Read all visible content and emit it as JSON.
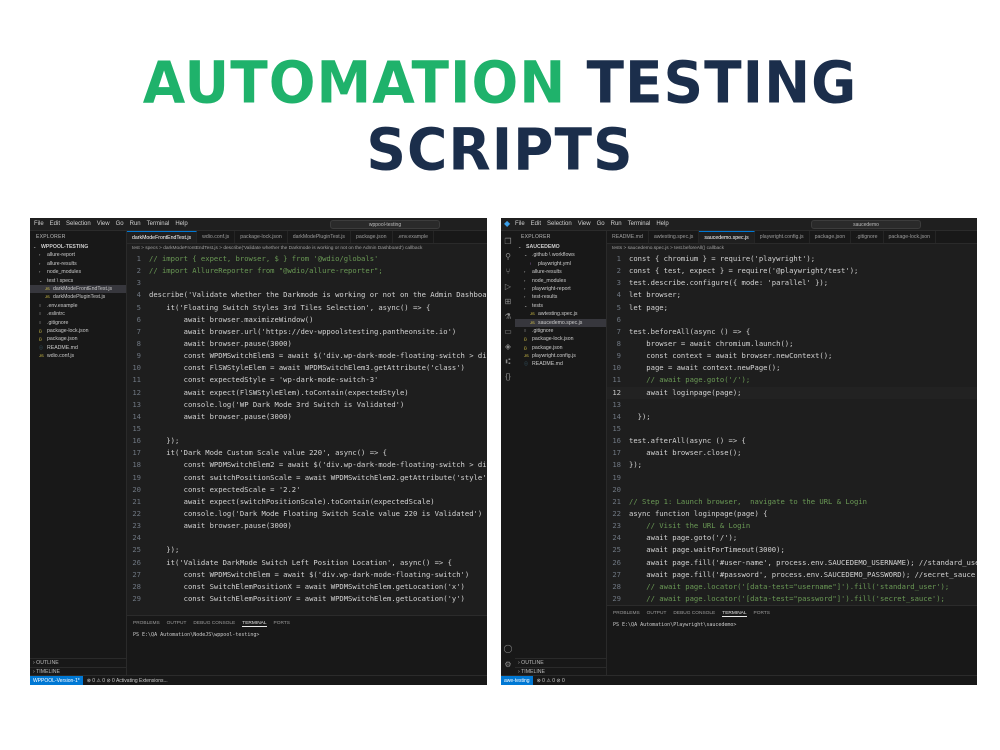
{
  "title": {
    "part1": "AUTOMATION",
    "part2": "TESTING SCRIPTS"
  },
  "colors": {
    "title_green": "#1fb26b",
    "title_navy": "#1b2e4b",
    "editor_bg": "#1e1e1e",
    "accent_blue": "#0078d4"
  },
  "left": {
    "menu": [
      "File",
      "Edit",
      "Selection",
      "View",
      "Go",
      "Run",
      "Terminal",
      "Help"
    ],
    "search": "wppool-testing",
    "explorer_title": "EXPLORER",
    "tree": [
      {
        "label": "WPPOOL-TESTING",
        "indent": 0,
        "icon": "chevron-down-icon"
      },
      {
        "label": "allure-report",
        "indent": 1,
        "icon": "chevron-right-icon"
      },
      {
        "label": "allure-results",
        "indent": 1,
        "icon": "chevron-right-icon"
      },
      {
        "label": "node_modules",
        "indent": 1,
        "icon": "chevron-right-icon"
      },
      {
        "label": "test \\ specs",
        "indent": 1,
        "icon": "chevron-down-icon"
      },
      {
        "label": "darkModeFrontEndTest.js",
        "indent": 2,
        "icon": "js-file-icon",
        "selected": true
      },
      {
        "label": "darkModePluginTest.js",
        "indent": 2,
        "icon": "js-file-icon"
      },
      {
        "label": ".env.example",
        "indent": 1,
        "icon": "file-icon"
      },
      {
        "label": ".eslintrc",
        "indent": 1,
        "icon": "file-icon"
      },
      {
        "label": ".gitignore",
        "indent": 1,
        "icon": "file-icon"
      },
      {
        "label": "package-lock.json",
        "indent": 1,
        "icon": "json-file-icon"
      },
      {
        "label": "package.json",
        "indent": 1,
        "icon": "json-file-icon"
      },
      {
        "label": "README.md",
        "indent": 1,
        "icon": "info-file-icon"
      },
      {
        "label": "wdio.conf.js",
        "indent": 1,
        "icon": "js-file-icon"
      }
    ],
    "outline": "OUTLINE",
    "timeline": "TIMELINE",
    "tabs": [
      "darkModeFrontEndTest.js",
      "wdio.conf.js",
      "package-lock.json",
      "darkModePluginTest.js",
      "package.json",
      ".env.example"
    ],
    "breadcrumb": "test > specs > darkModeFrontEndTest.js > describe('Validate whether the Darkmode is working or not on the Admin Dashboard') callback",
    "code": [
      "// import { expect, browser, $ } from '@wdio/globals'",
      "// import AllureReporter from \"@wdio/allure-reporter\";",
      "",
      "describe('Validate whether the Darkmode is working or not on the Admin Dashboard', () => {",
      "    it('Floating Switch Styles 3rd Tiles Selection', async() => {",
      "        await browser.maximizeWindow()",
      "        await browser.url('https://dev-wppoolstesting.pantheonsite.io')",
      "        await browser.pause(3000)",
      "        const WPDMSwitchElem3 = await $('div.wp-dark-mode-floating-switch > div > div')",
      "        const FlSWStyleElem = await WPDMSwitchElem3.getAttribute('class')",
      "        const expectedStyle = 'wp-dark-mode-switch-3'",
      "        await expect(FlSWStyleElem).toContain(expectedStyle)",
      "        console.log('WP Dark Mode 3rd Switch is Validated')",
      "        await browser.pause(3000)",
      "",
      "    });",
      "    it('Dark Mode Custom Scale value 220', async() => {",
      "        const WPDMSwitchElem2 = await $('div.wp-dark-mode-floating-switch > div > div')",
      "        const switchPositionScale = await WPDMSwitchElem2.getAttribute('style')",
      "        const expectedScale = '2.2'",
      "        await expect(switchPositionScale).toContain(expectedScale)",
      "        console.log('Dark Mode Floating Switch Scale value 220 is Validated')",
      "        await browser.pause(3000)",
      "",
      "    });",
      "    it('Validate DarkMode Switch Left Position Location', async() => {",
      "        const WPDMSwitchElem = await $('div.wp-dark-mode-floating-switch')",
      "        const SwitchElemPositionX = await WPDMSwitchElem.getLocation('x')",
      "        const SwitchElemPositionY = await WPDMSwitchElem.getLocation('y')"
    ],
    "panel_tabs": [
      "PROBLEMS",
      "OUTPUT",
      "DEBUG CONSOLE",
      "TERMINAL",
      "PORTS"
    ],
    "active_panel": "TERMINAL",
    "terminal": "PS E:\\QA Automation\\NodeJS\\wppool-testing>",
    "status": "⊗ 0 ⚠ 0   ⊘ 0   Activating Extensions...",
    "remote": "WPPOOL-Version-1*"
  },
  "right": {
    "menu": [
      "File",
      "Edit",
      "Selection",
      "View",
      "Go",
      "Run",
      "Terminal",
      "Help"
    ],
    "search": "saucedemo",
    "explorer_title": "EXPLORER",
    "tree": [
      {
        "label": "SAUCEDEMO",
        "indent": 0,
        "icon": "chevron-down-icon"
      },
      {
        "label": ".github \\ workflows",
        "indent": 1,
        "icon": "chevron-down-icon"
      },
      {
        "label": "playwright.yml",
        "indent": 2,
        "icon": "yml-file-icon"
      },
      {
        "label": "allure-results",
        "indent": 1,
        "icon": "chevron-right-icon"
      },
      {
        "label": "node_modules",
        "indent": 1,
        "icon": "chevron-right-icon"
      },
      {
        "label": "playwright-report",
        "indent": 1,
        "icon": "chevron-right-icon"
      },
      {
        "label": "test-results",
        "indent": 1,
        "icon": "chevron-right-icon"
      },
      {
        "label": "tests",
        "indent": 1,
        "icon": "chevron-down-icon"
      },
      {
        "label": "awtesting.spec.js",
        "indent": 2,
        "icon": "js-file-icon"
      },
      {
        "label": "saucedemo.spec.js",
        "indent": 2,
        "icon": "js-file-icon",
        "selected": true
      },
      {
        "label": ".gitignore",
        "indent": 1,
        "icon": "file-icon"
      },
      {
        "label": "package-lock.json",
        "indent": 1,
        "icon": "json-file-icon"
      },
      {
        "label": "package.json",
        "indent": 1,
        "icon": "json-file-icon"
      },
      {
        "label": "playwright.config.js",
        "indent": 1,
        "icon": "js-file-icon"
      },
      {
        "label": "README.md",
        "indent": 1,
        "icon": "info-file-icon"
      }
    ],
    "outline": "OUTLINE",
    "timeline": "TIMELINE",
    "tabs": [
      "README.md",
      "awtesting.spec.js",
      "saucedemo.spec.js",
      "playwright.config.js",
      "package.json",
      ".gitignore",
      "package-lock.json"
    ],
    "breadcrumb": "tests > saucedemo.spec.js > test.beforeAll() callback",
    "code_start": 1,
    "current_line": 12,
    "code": [
      "const { chromium } = require('playwright');",
      "const { test, expect } = require('@playwright/test');",
      "test.describe.configure({ mode: 'parallel' });",
      "let browser;",
      "let page;",
      "",
      "test.beforeAll(async () => {",
      "    browser = await chromium.launch();",
      "    const context = await browser.newContext();",
      "    page = await context.newPage();",
      "    // await page.goto('/');",
      "    await loginpage(page);",
      "",
      "  });",
      "",
      "test.afterAll(async () => {",
      "    await browser.close();",
      "});",
      "",
      "",
      "// Step 1: Launch browser,  navigate to the URL & Login",
      "async function loginpage(page) {",
      "    // Visit the URL & Login",
      "    await page.goto('/');",
      "    await page.waitForTimeout(3000);",
      "    await page.fill('#user-name', process.env.SAUCEDEMO_USERNAME); //standard_user",
      "    await page.fill('#password', process.env.SAUCEDEMO_PASSWORD); //secret_sauce",
      "    // await page.locator('[data-test=\"username\"]').fill('standard_user');",
      "    // await page.locator('[data-test=\"password\"]').fill('secret_sauce');",
      "    await page.waitForTimeout(3000);"
    ],
    "panel_tabs": [
      "PROBLEMS",
      "OUTPUT",
      "DEBUG CONSOLE",
      "TERMINAL",
      "PORTS"
    ],
    "active_panel": "TERMINAL",
    "terminal": "PS E:\\QA Automation\\Playwright\\saucedemo>",
    "status": "⊗ 0 ⚠ 0   ⊘ 0",
    "remote": "awe-testing"
  }
}
